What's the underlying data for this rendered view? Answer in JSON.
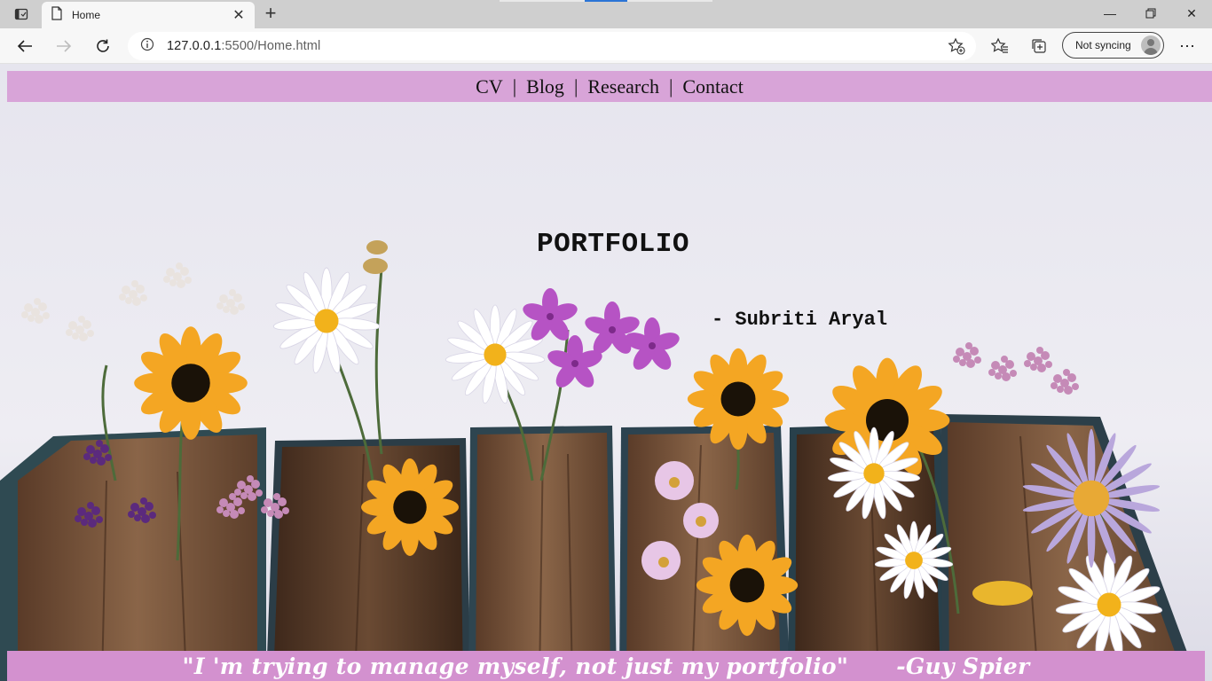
{
  "browser": {
    "tab_title": "Home",
    "address": {
      "host": "127.0.0.1",
      "rest": ":5500/Home.html"
    },
    "sync_label": "Not syncing"
  },
  "page": {
    "nav": {
      "items": [
        "CV",
        "Blog",
        "Research",
        "Contact"
      ],
      "separator": "|"
    },
    "title": "PORTFOLIO",
    "author": "- Subriti Aryal",
    "quote": "\"I 'm trying to manage myself, not just my portfolio\"",
    "quote_author": "-Guy Spier"
  },
  "colors": {
    "nav_background": "#d8a4d8",
    "footer_background": "#d391cf",
    "page_background": "#e9e8f0"
  }
}
